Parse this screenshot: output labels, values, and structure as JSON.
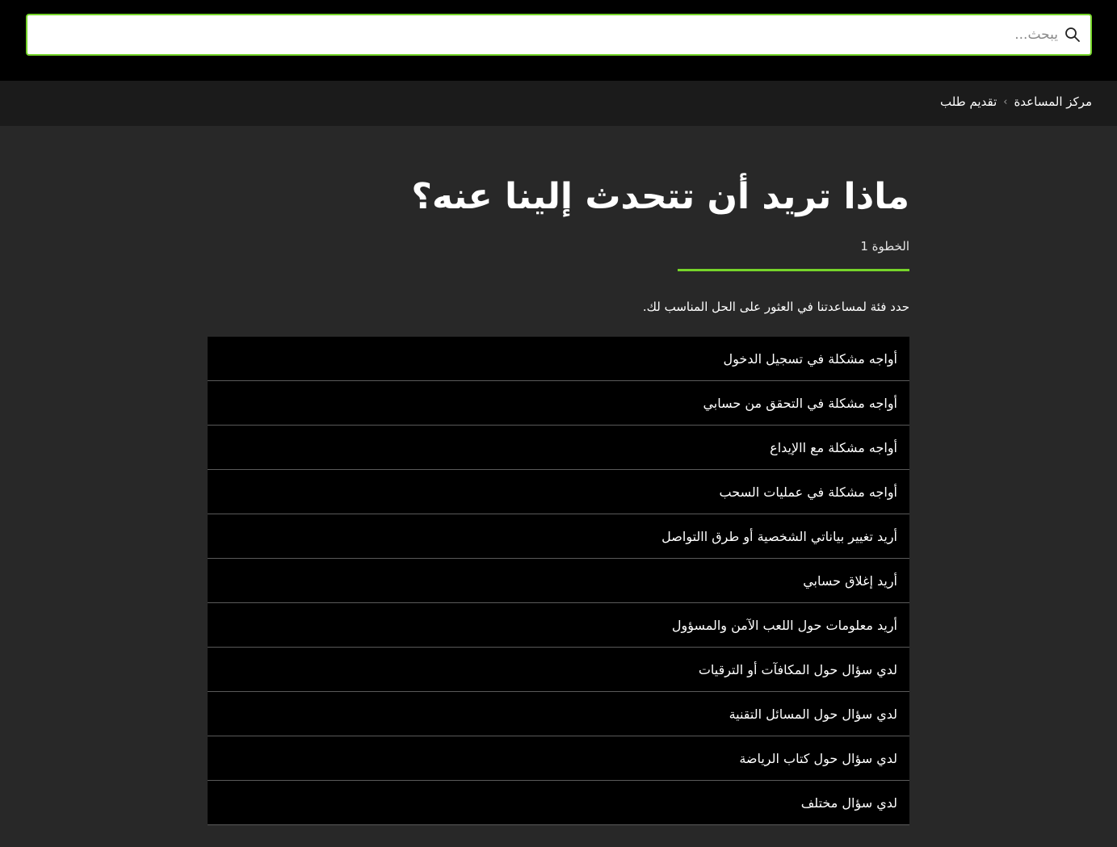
{
  "search": {
    "placeholder": "يبحث..."
  },
  "breadcrumb": {
    "items": [
      "مركز المساعدة",
      "تقديم طلب"
    ],
    "separator": "›"
  },
  "main": {
    "title": "ماذا تريد أن تتحدث إلينا عنه؟",
    "step": "الخطوة 1",
    "instructions": "حدد فئة لمساعدتنا في العثور على الحل المناسب لك.",
    "categories": [
      "أواجه مشكلة في تسجيل الدخول",
      "أواجه مشكلة في التحقق من حسابي",
      "أواجه مشكلة مع االإيداع",
      "أواجه مشكلة في عمليات السحب",
      "أريد تغيير بياناتي الشخصية أو طرق االتواصل",
      "أريد إغلاق حسابي",
      "أريد معلومات حول اللعب الآمن والمسؤول",
      "لدي سؤال حول المكافآت أو الترقيات",
      "لدي سؤال حول المسائل التقنية",
      "لدي سؤال حول كتاب الرياضة",
      "لدي سؤال مختلف"
    ]
  },
  "colors": {
    "accent": "#76d42a",
    "background": "#282828",
    "topbar": "#000000",
    "breadcrumb_bar": "#1b1b1b"
  }
}
